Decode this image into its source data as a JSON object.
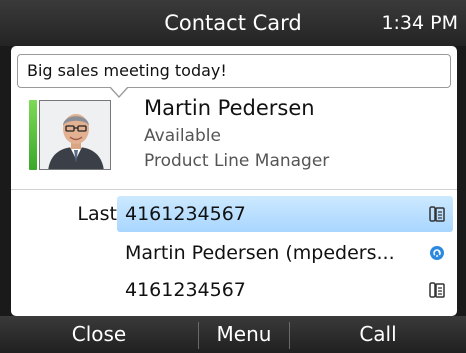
{
  "header": {
    "title": "Contact Card",
    "time": "1:34 PM"
  },
  "contact": {
    "status_message": "Big sales meeting today!",
    "name": "Martin Pedersen",
    "availability": "Available",
    "job_title": "Product Line Manager",
    "presence_color": "#4cc23a"
  },
  "entries": [
    {
      "label": "Last",
      "value": "4161234567",
      "icon": "phone-icon",
      "selected": true
    },
    {
      "label": "",
      "value": "Martin Pedersen (mpeders...",
      "icon": "chat-icon",
      "selected": false
    },
    {
      "label": "",
      "value": "4161234567",
      "icon": "phone-icon",
      "selected": false
    }
  ],
  "softkeys": {
    "close": "Close",
    "menu": "Menu",
    "call": "Call"
  },
  "colors": {
    "accent": "#2a8ae0",
    "highlight": "#b9dcff"
  }
}
